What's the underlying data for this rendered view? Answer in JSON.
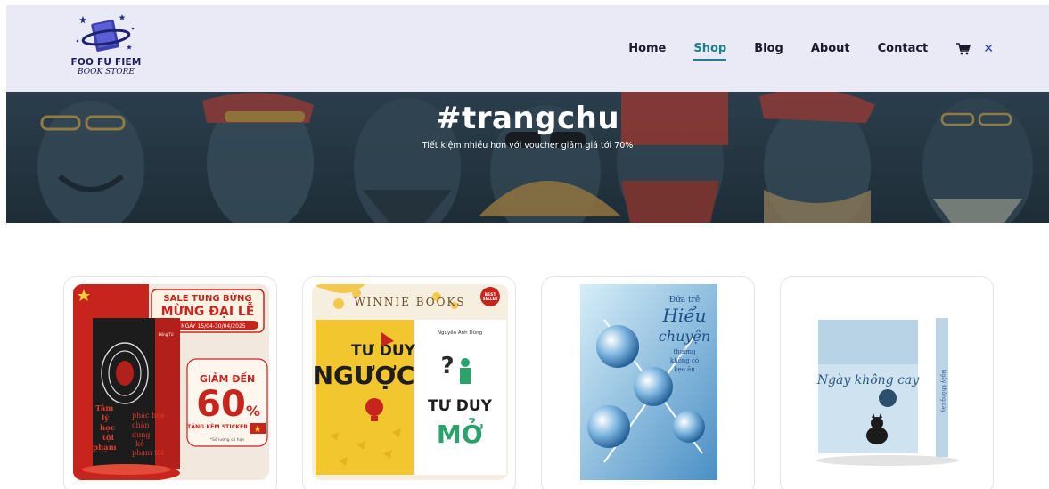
{
  "brand": {
    "name": "FOO FU FIEM",
    "tagline": "BOOK STORE"
  },
  "nav": {
    "items": [
      {
        "label": "Home",
        "active": false
      },
      {
        "label": "Shop",
        "active": true
      },
      {
        "label": "Blog",
        "active": false
      },
      {
        "label": "About",
        "active": false
      },
      {
        "label": "Contact",
        "active": false
      }
    ],
    "accent_color": "#1f7f8a"
  },
  "hero": {
    "title": "#trangchu",
    "subtitle": "Tiết kiệm nhiều hơn với voucher giảm giá tới 70%"
  },
  "products": [
    {
      "banner": "SALE TUNG BỪNG",
      "banner2": "MỪNG ĐẠI LỄ",
      "date": "TỪ NGÀY 15/04-30/04/2025",
      "discount_label": "GIẢM ĐẾN",
      "discount": "60",
      "discount_unit": "%",
      "gift": "TẶNG KÈM STICKER",
      "note": "*Số lượng có hạn",
      "book_title_1": "Tâm",
      "book_title_2": "lý",
      "book_title_3": "học",
      "book_title_4": "tội",
      "book_title_5": "phạm",
      "book_side_1": "phác họa",
      "book_side_2": "chân",
      "book_side_3": "dung",
      "book_side_4": "kẻ",
      "book_side_5": "phạm tội",
      "author": "Đồng Tử"
    },
    {
      "publisher": "WINNIE BOOKS",
      "badge": "BEST SELLER",
      "left_title_1": "TƯ DUY",
      "left_title_2": "NGƯỢC",
      "right_author": "Nguyễn Anh Dũng",
      "right_title_1": "TƯ DUY",
      "right_title_2": "MỞ"
    },
    {
      "title_1": "Đứa trẻ",
      "title_2": "Hiểu",
      "title_3": "chuyện",
      "title_4": "thường",
      "title_5": "không có",
      "title_6": "kẹo ăn"
    },
    {
      "cover_script": "Ngày không cay",
      "spine": "Ngày không cay"
    }
  ]
}
